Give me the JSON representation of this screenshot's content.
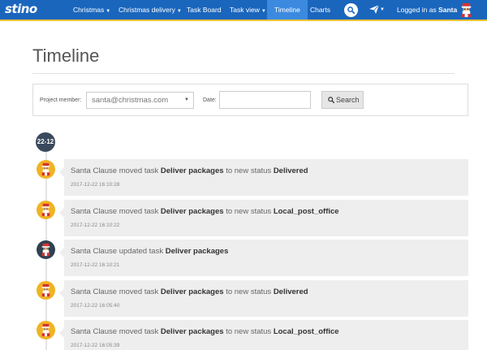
{
  "nav": {
    "brand": "stino",
    "items": [
      {
        "label": "Christmas",
        "caret": true,
        "active": false
      },
      {
        "label": "Christmas delivery",
        "caret": true,
        "active": false
      },
      {
        "label": "Task Board",
        "caret": false,
        "active": false
      },
      {
        "label": "Task view",
        "caret": true,
        "active": false
      },
      {
        "label": "Timeline",
        "caret": false,
        "active": true
      },
      {
        "label": "Charts",
        "caret": false,
        "active": false
      }
    ],
    "login_prefix": "Logged in as",
    "login_user": "Santa",
    "icons": [
      "search-icon",
      "paper-plane-icon",
      "santa-avatar"
    ]
  },
  "page": {
    "title": "Timeline"
  },
  "filter": {
    "member_label": "Project member:",
    "member_value": "santa@christmas.com",
    "date_label": "Date:",
    "date_value": "",
    "search_label": "Search"
  },
  "timeline": {
    "date_badge": "22-12",
    "events": [
      {
        "actor": "Santa Clause",
        "verb": "moved task",
        "task": "Deliver packages",
        "mid": "to new status",
        "status": "Delivered",
        "time": "2017-12-22 16:10:28",
        "avatar": "gold"
      },
      {
        "actor": "Santa Clause",
        "verb": "moved task",
        "task": "Deliver packages",
        "mid": "to new status",
        "status": "Local_post_office",
        "time": "2017-12-22 16:10:22",
        "avatar": "gold"
      },
      {
        "actor": "Santa Clause",
        "verb": "updated task",
        "task": "Deliver packages",
        "mid": "",
        "status": "",
        "time": "2017-12-22 16:10:21",
        "avatar": "dark"
      },
      {
        "actor": "Santa Clause",
        "verb": "moved task",
        "task": "Deliver packages",
        "mid": "to new status",
        "status": "Delivered",
        "time": "2017-12-22 16:05:40",
        "avatar": "gold"
      },
      {
        "actor": "Santa Clause",
        "verb": "moved task",
        "task": "Deliver packages",
        "mid": "to new status",
        "status": "Local_post_office",
        "time": "2017-12-22 16:05:39",
        "avatar": "gold"
      }
    ]
  },
  "colors": {
    "navbar": "#1a66bd",
    "navbar_active": "#3b8ae0",
    "navbar_border": "#e8c23a",
    "avatar_gold": "#f0b323",
    "avatar_dark": "#2f4150",
    "date_badge": "#3a4a5c",
    "card_bg": "#eeeeee"
  }
}
